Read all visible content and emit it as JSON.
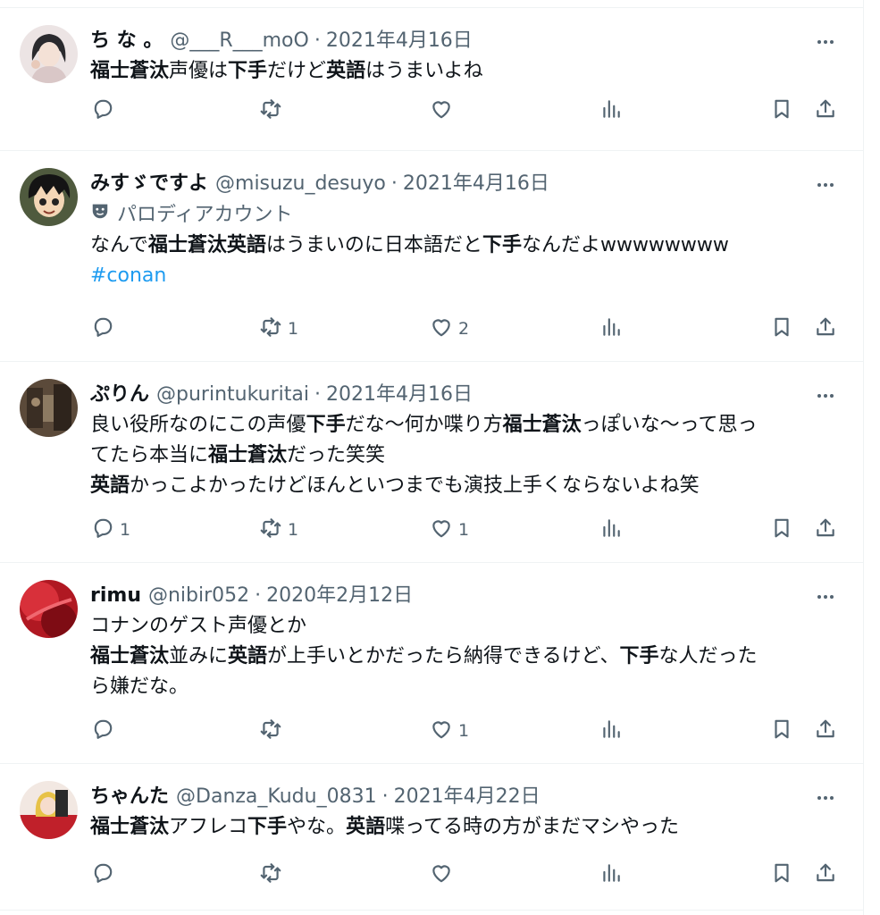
{
  "tweets": [
    {
      "name": "ち な 。",
      "handle": "@___R___moO",
      "separator": "·",
      "date": "2021年4月16日",
      "text_lines": [
        [
          {
            "t": "福士蒼汰",
            "b": true
          },
          {
            "t": "声優は"
          },
          {
            "t": "下手",
            "b": true
          },
          {
            "t": "だけど"
          },
          {
            "t": "英語",
            "b": true
          },
          {
            "t": "はうまいよね"
          }
        ]
      ],
      "replies": "",
      "retweets": "",
      "likes": ""
    },
    {
      "name": "みすゞですよ",
      "handle": "@misuzu_desuyo",
      "separator": "·",
      "date": "2021年4月16日",
      "parody_label": "パロディアカウント",
      "text_lines": [
        [
          {
            "t": "なんで"
          },
          {
            "t": "福士蒼汰英語",
            "b": true
          },
          {
            "t": "はうまいのに日本語だと"
          },
          {
            "t": "下手",
            "b": true
          },
          {
            "t": "なんだよwwwwwwww"
          }
        ],
        [
          {
            "t": "#conan",
            "link": true
          }
        ]
      ],
      "replies": "",
      "retweets": "1",
      "likes": "2"
    },
    {
      "name": "ぷりん",
      "handle": "@purintukuritai",
      "separator": "·",
      "date": "2021年4月16日",
      "text_lines": [
        [
          {
            "t": "良い役所なのにこの声優"
          },
          {
            "t": "下手",
            "b": true
          },
          {
            "t": "だな〜何か喋り方"
          },
          {
            "t": "福士蒼汰",
            "b": true
          },
          {
            "t": "っぽいな〜って思っ"
          }
        ],
        [
          {
            "t": "てたら本当に"
          },
          {
            "t": "福士蒼汰",
            "b": true
          },
          {
            "t": "だった笑笑"
          }
        ],
        [
          {
            "t": "英語",
            "b": true
          },
          {
            "t": "かっこよかったけどほんといつまでも演技上手くならないよね笑"
          }
        ]
      ],
      "replies": "1",
      "retweets": "1",
      "likes": "1"
    },
    {
      "name": "rimu",
      "handle": "@nibir052",
      "separator": "·",
      "date": "2020年2月12日",
      "text_lines": [
        [
          {
            "t": "コナンのゲスト声優とか"
          }
        ],
        [
          {
            "t": "福士蒼汰",
            "b": true
          },
          {
            "t": "並みに"
          },
          {
            "t": "英語",
            "b": true
          },
          {
            "t": "が上手いとかだったら納得できるけど、"
          },
          {
            "t": "下手",
            "b": true
          },
          {
            "t": "な人だった"
          }
        ],
        [
          {
            "t": "ら嫌だな。"
          }
        ]
      ],
      "replies": "",
      "retweets": "",
      "likes": "1"
    },
    {
      "name": "ちゃんた",
      "handle": "@Danza_Kudu_0831",
      "separator": "·",
      "date": "2021年4月22日",
      "text_lines": [
        [
          {
            "t": "福士蒼汰",
            "b": true
          },
          {
            "t": "アフレコ"
          },
          {
            "t": "下手",
            "b": true
          },
          {
            "t": "やな。"
          },
          {
            "t": "英語",
            "b": true
          },
          {
            "t": "喋ってる時の方がまだマシやった"
          }
        ]
      ],
      "replies": "",
      "retweets": "",
      "likes": ""
    }
  ],
  "colors": {
    "text": "#0f1419",
    "secondary": "#536471",
    "link": "#1d9bf0",
    "border": "#eff3f4"
  },
  "icons": {
    "reply": "speech-bubble-icon",
    "retweet": "retweet-arrows-icon",
    "like": "heart-icon",
    "views": "bar-chart-icon",
    "bookmark": "bookmark-icon",
    "share": "share-upload-icon",
    "more": "ellipsis-icon",
    "parody": "theater-mask-icon"
  }
}
